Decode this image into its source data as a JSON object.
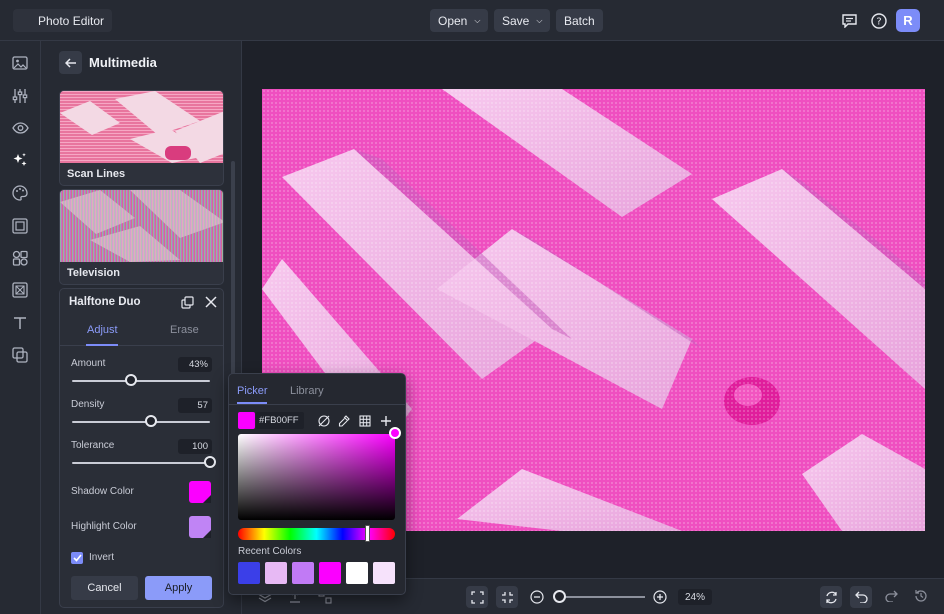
{
  "app": {
    "title": "Photo Editor"
  },
  "toolbar": {
    "open_label": "Open",
    "save_label": "Save",
    "batch_label": "Batch",
    "avatar_initial": "R"
  },
  "panel": {
    "title": "Multimedia",
    "thumbnails": [
      {
        "label": "Scan Lines"
      },
      {
        "label": "Television"
      }
    ]
  },
  "effect": {
    "title": "Halftone Duo",
    "tabs": [
      {
        "label": "Adjust",
        "active": true
      },
      {
        "label": "Erase",
        "active": false
      }
    ],
    "amount": {
      "label": "Amount",
      "value": "43%",
      "fraction": 0.43
    },
    "density": {
      "label": "Density",
      "value": "57",
      "fraction": 0.57
    },
    "tolerance": {
      "label": "Tolerance",
      "value": "100",
      "fraction": 1.0
    },
    "shadow_color": {
      "label": "Shadow Color",
      "color": "#FB00FF"
    },
    "highlight_color": {
      "label": "Highlight Color",
      "color": "#C084F5"
    },
    "invert": {
      "label": "Invert",
      "checked": true
    },
    "cancel_label": "Cancel",
    "apply_label": "Apply"
  },
  "picker": {
    "tabs": [
      {
        "label": "Picker",
        "active": true
      },
      {
        "label": "Library",
        "active": false
      }
    ],
    "hex_value": "#FB00FF",
    "recent_label": "Recent Colors",
    "recent_colors": [
      "#3B3FE8",
      "#E7B9F4",
      "#C17AF5",
      "#FB00FF",
      "#FFFFFF",
      "#F6E2FB"
    ]
  },
  "zoom": {
    "value": "24%",
    "fraction": 0.0
  },
  "colors": {
    "accent": "#7C8CF8",
    "photo_pink": "#F04FC0"
  }
}
